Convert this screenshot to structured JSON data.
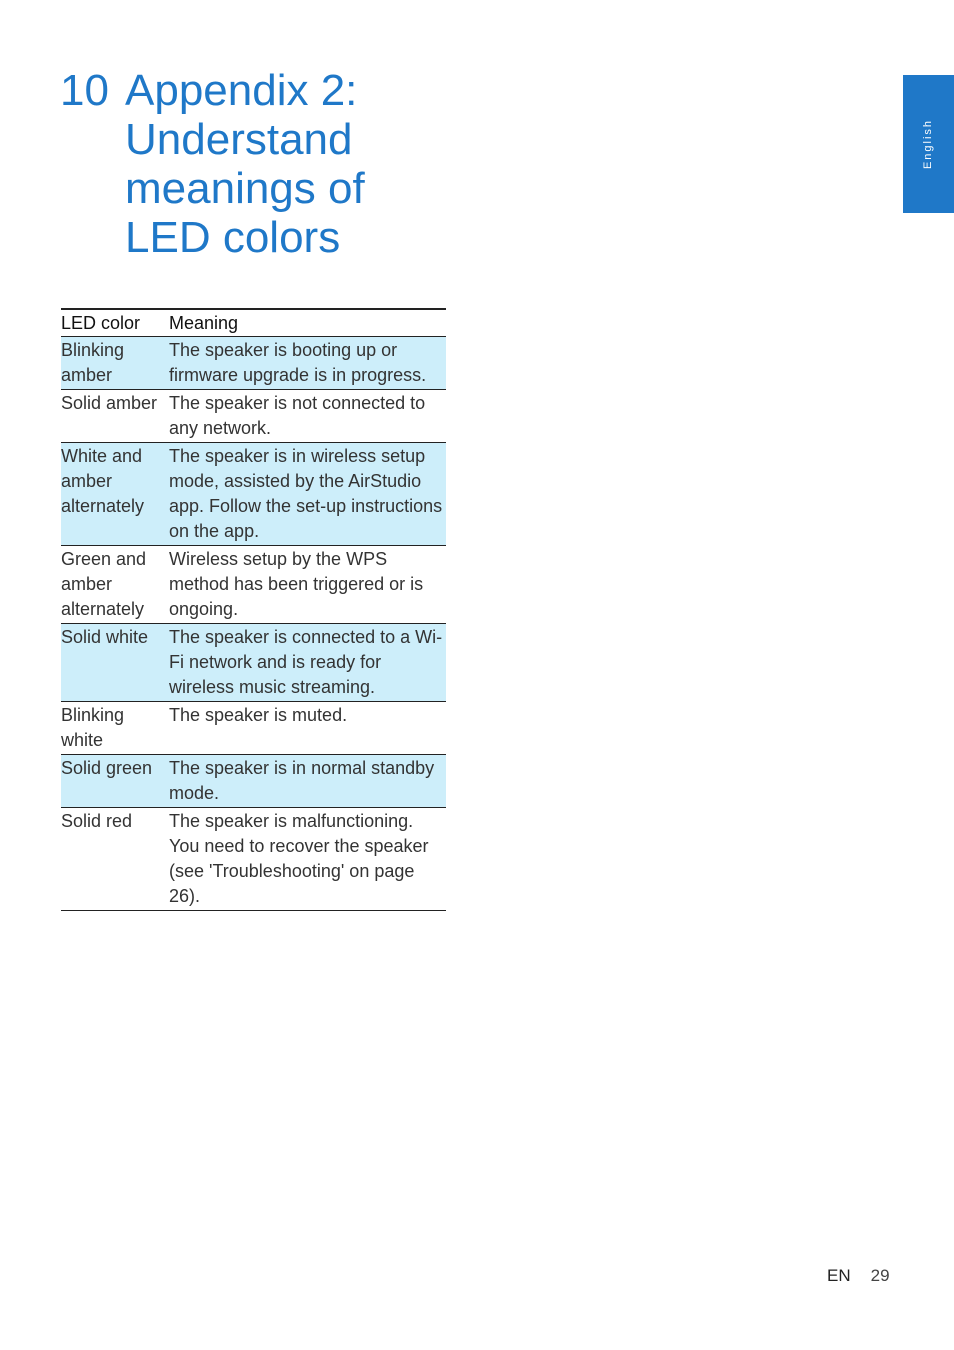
{
  "chapter": {
    "number": "10",
    "title": "Appendix 2:\nUnderstand\nmeanings of\nLED colors"
  },
  "language_tab": "English",
  "table": {
    "headers": [
      "LED color",
      "Meaning"
    ],
    "rows": [
      {
        "color": "Blinking amber",
        "meaning": "The speaker is booting up or firmware upgrade is in progress.",
        "shaded": true
      },
      {
        "color": "Solid amber",
        "meaning": "The speaker is not connected to any network.",
        "shaded": false
      },
      {
        "color": "White and amber alternately",
        "meaning": "The speaker is in wireless setup mode, assisted by the AirStudio app. Follow the set-up instructions on the app.",
        "shaded": true
      },
      {
        "color": "Green and amber alternately",
        "meaning": "Wireless setup by the WPS method has been triggered or is ongoing.",
        "shaded": false
      },
      {
        "color": "Solid white",
        "meaning": "The speaker is connected to a Wi-Fi network and is ready for wireless music streaming.",
        "shaded": true
      },
      {
        "color": "Blinking white",
        "meaning": "The speaker is muted.",
        "shaded": false
      },
      {
        "color": "Solid green",
        "meaning": "The speaker is in normal standby mode.",
        "shaded": true
      },
      {
        "color": "Solid red",
        "meaning": "The speaker is malfunctioning. You need to recover the speaker (see 'Troubleshooting' on page 26).",
        "shaded": false
      }
    ]
  },
  "footer": {
    "lang": "EN",
    "page": "29"
  },
  "colors": {
    "accent": "#1f78c8",
    "row_shade": "#cdeefa"
  }
}
